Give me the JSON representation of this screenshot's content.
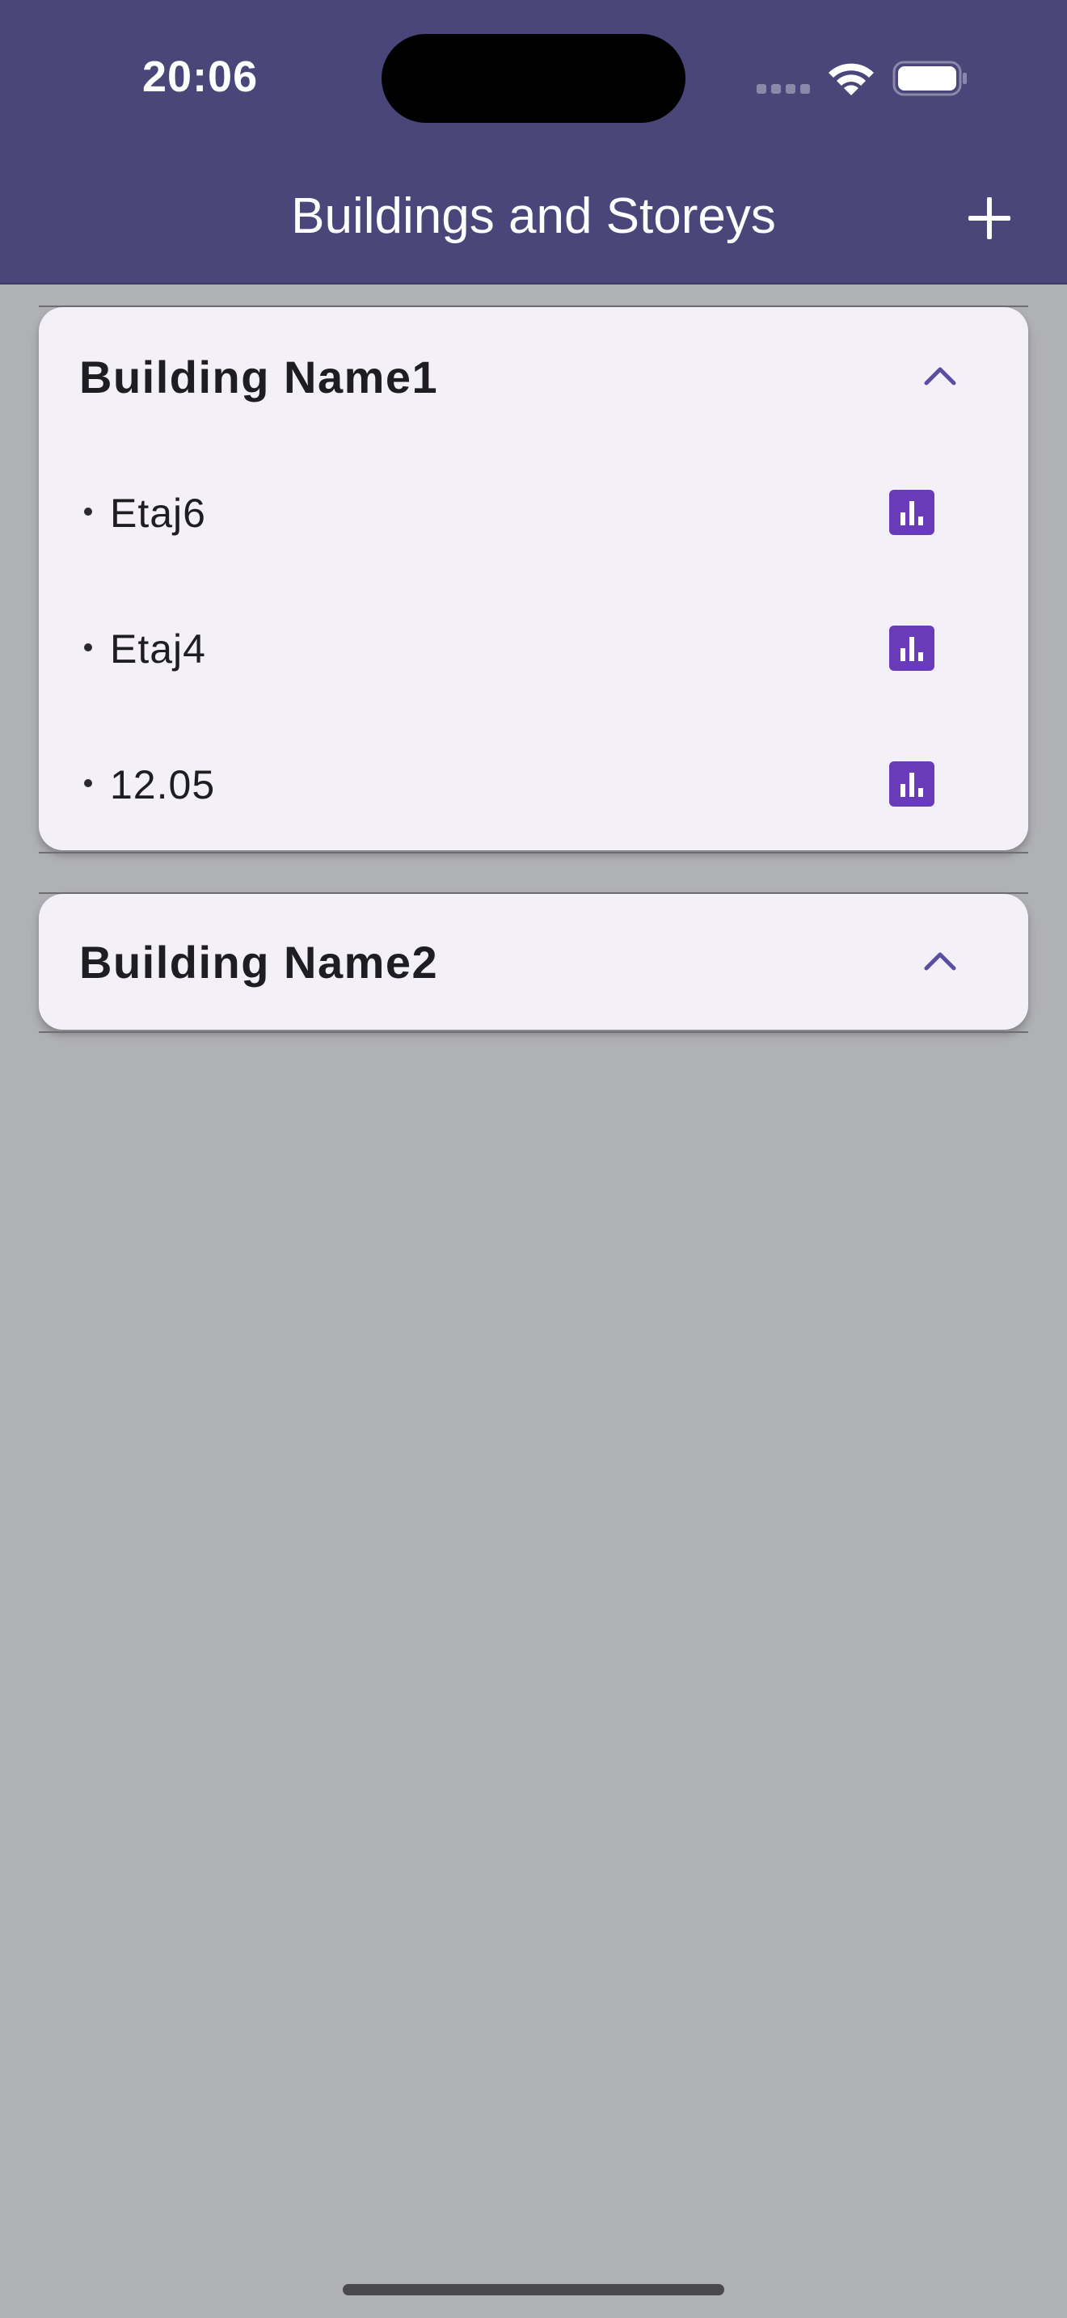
{
  "status_bar": {
    "time": "20:06"
  },
  "app_bar": {
    "title": "Buildings and Storeys",
    "add_icon": "plus-icon"
  },
  "buildings": [
    {
      "name": "Building Name1",
      "expanded": true,
      "storeys": [
        {
          "label": "Etaj6",
          "icon": "bar-chart-icon"
        },
        {
          "label": "Etaj4",
          "icon": "bar-chart-icon"
        },
        {
          "label": "12.05",
          "icon": "bar-chart-icon"
        }
      ]
    },
    {
      "name": "Building Name2",
      "expanded": true,
      "storeys": []
    }
  ],
  "colors": {
    "app_bar": "#4b4679",
    "background": "#b0b1b5",
    "card": "#f4f0f7",
    "accent": "#6a3bb8",
    "chevron": "#5b4ea0"
  }
}
